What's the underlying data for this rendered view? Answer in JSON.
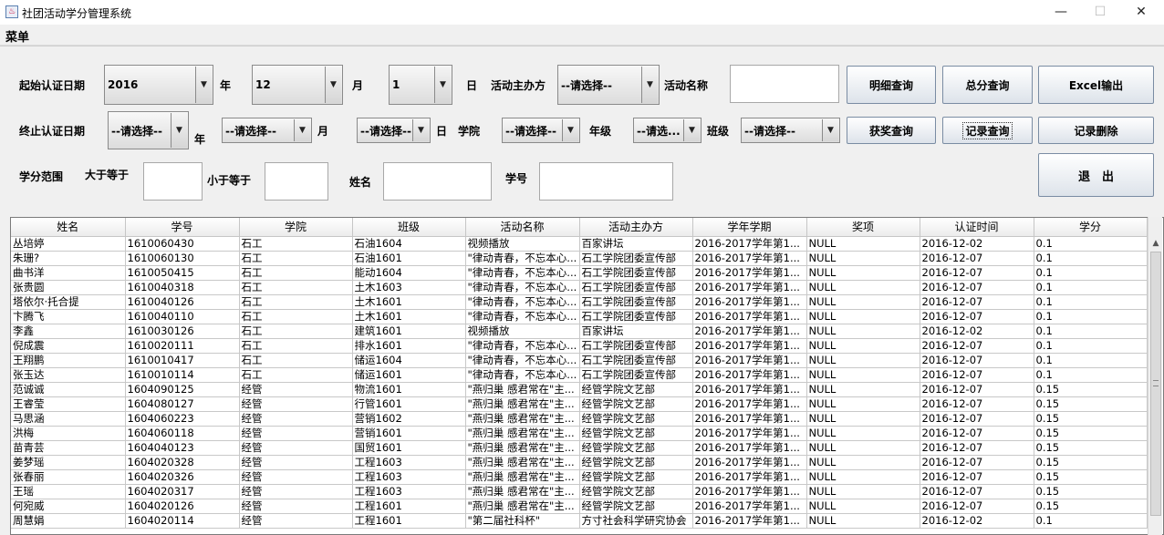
{
  "window": {
    "title": "社团活动学分管理系统",
    "app_icon": "java-cup-icon",
    "minimize": "—",
    "maximize": "☐",
    "close": "✕"
  },
  "menu": {
    "label": "菜单"
  },
  "form": {
    "start_label": "起始认证日期",
    "start_year": "2016",
    "year_label": "年",
    "start_month": "12",
    "month_label": "月",
    "start_day": "1",
    "day_label": "日",
    "organizer_label": "活动主办方",
    "organizer_value": "--请选择--",
    "activity_label": "活动名称",
    "activity_value": "",
    "end_label": "终止认证日期",
    "end_year": "--请选择--",
    "end_month": "--请选择--",
    "end_day": "--请选择--",
    "college_label": "学院",
    "college_value": "--请选择--",
    "grade_label": "年级",
    "grade_value": "--请选...",
    "class_label": "班级",
    "class_value": "--请选择--",
    "credit_range_label": "学分范围",
    "gte_label": "大于等于",
    "lte_label": "小于等于",
    "gte_value": "",
    "lte_value": "",
    "name_label": "姓名",
    "name_value": "",
    "student_id_label": "学号",
    "student_id_value": ""
  },
  "buttons": {
    "detail_query": "明细查询",
    "total_query": "总分查询",
    "excel_export": "Excel输出",
    "award_query": "获奖查询",
    "record_query": "记录查询",
    "record_delete": "记录删除",
    "exit": "退　出"
  },
  "table": {
    "columns": [
      "姓名",
      "学号",
      "学院",
      "班级",
      "活动名称",
      "活动主办方",
      "学年学期",
      "奖项",
      "认证时间",
      "学分"
    ],
    "rows": [
      [
        "丛培婷",
        "1610060430",
        "石工",
        "石油1604",
        "视频播放",
        "百家讲坛",
        "2016-2017学年第1...",
        "NULL",
        "2016-12-02",
        "0.1"
      ],
      [
        "朱珊?",
        "1610060130",
        "石工",
        "石油1601",
        "\"律动青春，不忘本心...",
        "石工学院团委宣传部",
        "2016-2017学年第1...",
        "NULL",
        "2016-12-07",
        "0.1"
      ],
      [
        "曲书洋",
        "1610050415",
        "石工",
        "能动1604",
        "\"律动青春，不忘本心...",
        "石工学院团委宣传部",
        "2016-2017学年第1...",
        "NULL",
        "2016-12-07",
        "0.1"
      ],
      [
        "张贵圆",
        "1610040318",
        "石工",
        "土木1603",
        "\"律动青春，不忘本心...",
        "石工学院团委宣传部",
        "2016-2017学年第1...",
        "NULL",
        "2016-12-07",
        "0.1"
      ],
      [
        "塔依尔·托合提",
        "1610040126",
        "石工",
        "土木1601",
        "\"律动青春，不忘本心...",
        "石工学院团委宣传部",
        "2016-2017学年第1...",
        "NULL",
        "2016-12-07",
        "0.1"
      ],
      [
        "卞腾飞",
        "1610040110",
        "石工",
        "土木1601",
        "\"律动青春，不忘本心...",
        "石工学院团委宣传部",
        "2016-2017学年第1...",
        "NULL",
        "2016-12-07",
        "0.1"
      ],
      [
        "李鑫",
        "1610030126",
        "石工",
        "建筑1601",
        "视频播放",
        "百家讲坛",
        "2016-2017学年第1...",
        "NULL",
        "2016-12-02",
        "0.1"
      ],
      [
        "倪成震",
        "1610020111",
        "石工",
        "排水1601",
        "\"律动青春，不忘本心...",
        "石工学院团委宣传部",
        "2016-2017学年第1...",
        "NULL",
        "2016-12-07",
        "0.1"
      ],
      [
        "王翔鹏",
        "1610010417",
        "石工",
        "储运1604",
        "\"律动青春，不忘本心...",
        "石工学院团委宣传部",
        "2016-2017学年第1...",
        "NULL",
        "2016-12-07",
        "0.1"
      ],
      [
        "张玉达",
        "1610010114",
        "石工",
        "储运1601",
        "\"律动青春，不忘本心...",
        "石工学院团委宣传部",
        "2016-2017学年第1...",
        "NULL",
        "2016-12-07",
        "0.1"
      ],
      [
        "范诚诚",
        "1604090125",
        "经管",
        "物流1601",
        "\"燕归巢 感君常在\"主...",
        "经管学院文艺部",
        "2016-2017学年第1...",
        "NULL",
        "2016-12-07",
        "0.15"
      ],
      [
        "王睿莹",
        "1604080127",
        "经管",
        "行管1601",
        "\"燕归巢 感君常在\"主...",
        "经管学院文艺部",
        "2016-2017学年第1...",
        "NULL",
        "2016-12-07",
        "0.15"
      ],
      [
        "马思涵",
        "1604060223",
        "经管",
        "营销1602",
        "\"燕归巢 感君常在\"主...",
        "经管学院文艺部",
        "2016-2017学年第1...",
        "NULL",
        "2016-12-07",
        "0.15"
      ],
      [
        "洪梅",
        "1604060118",
        "经管",
        "营销1601",
        "\"燕归巢 感君常在\"主...",
        "经管学院文艺部",
        "2016-2017学年第1...",
        "NULL",
        "2016-12-07",
        "0.15"
      ],
      [
        "苗青芸",
        "1604040123",
        "经管",
        "国贸1601",
        "\"燕归巢 感君常在\"主...",
        "经管学院文艺部",
        "2016-2017学年第1...",
        "NULL",
        "2016-12-07",
        "0.15"
      ],
      [
        "姜梦瑶",
        "1604020328",
        "经管",
        "工程1603",
        "\"燕归巢 感君常在\"主...",
        "经管学院文艺部",
        "2016-2017学年第1...",
        "NULL",
        "2016-12-07",
        "0.15"
      ],
      [
        "张春丽",
        "1604020326",
        "经管",
        "工程1603",
        "\"燕归巢 感君常在\"主...",
        "经管学院文艺部",
        "2016-2017学年第1...",
        "NULL",
        "2016-12-07",
        "0.15"
      ],
      [
        "王瑶",
        "1604020317",
        "经管",
        "工程1603",
        "\"燕归巢 感君常在\"主...",
        "经管学院文艺部",
        "2016-2017学年第1...",
        "NULL",
        "2016-12-07",
        "0.15"
      ],
      [
        "何宛威",
        "1604020126",
        "经管",
        "工程1601",
        "\"燕归巢 感君常在\"主...",
        "经管学院文艺部",
        "2016-2017学年第1...",
        "NULL",
        "2016-12-07",
        "0.15"
      ],
      [
        "周慧娟",
        "1604020114",
        "经管",
        "工程1601",
        "\"第二届社科杯\"",
        "方寸社会科学研究协会",
        "2016-2017学年第1...",
        "NULL",
        "2016-12-02",
        "0.1"
      ]
    ]
  }
}
